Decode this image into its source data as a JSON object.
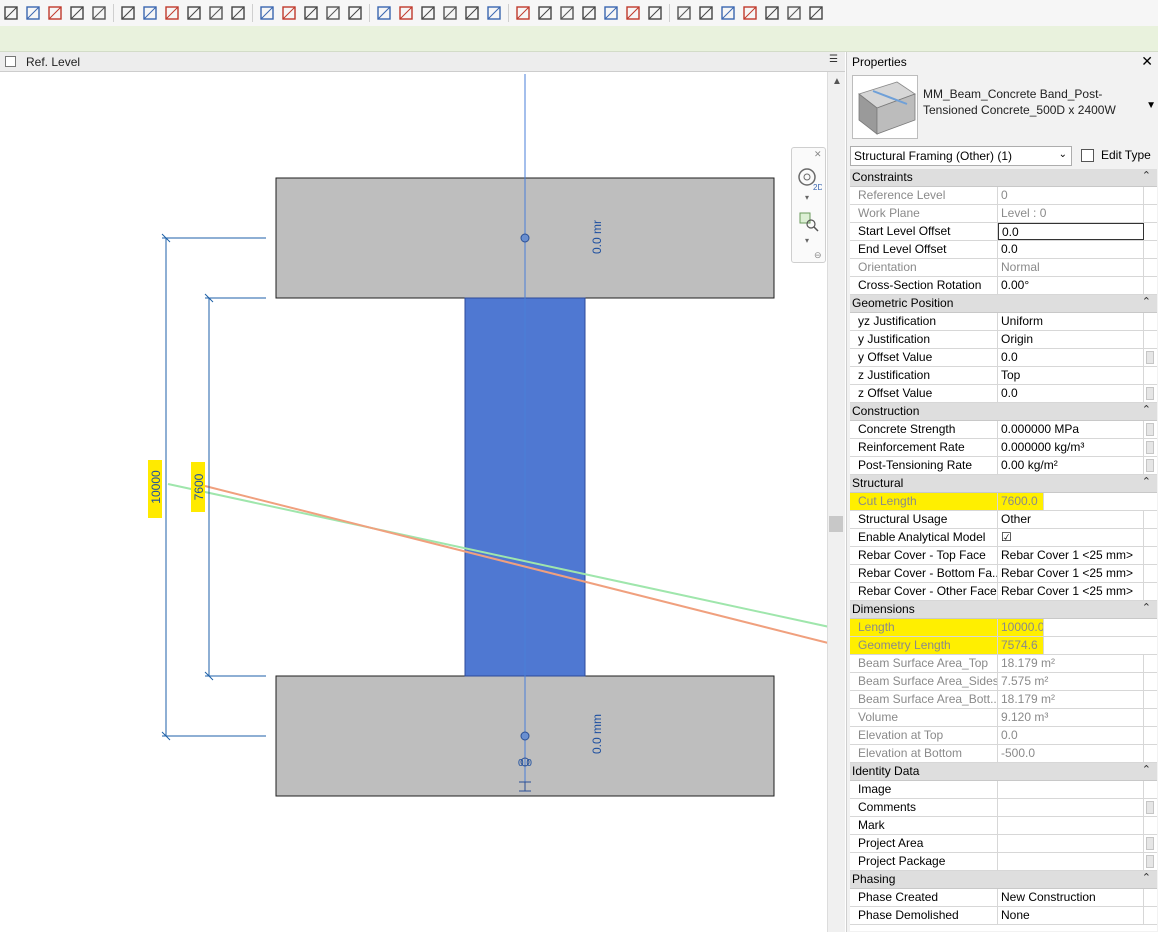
{
  "toolbar": {
    "icons": [
      "align-icon",
      "split-element-icon",
      "trim-icon",
      "rotate-icon",
      "array-icon",
      "mirror-icon",
      "dimension-icon",
      "measure-icon",
      "angular-icon",
      "arc-icon",
      "circle-icon",
      "spline-icon",
      "point-icon",
      "target-icon",
      "tag-icon",
      "region-icon",
      "wall-icon",
      "opening-icon",
      "text-icon",
      "frame-icon",
      "shape-icon",
      "cube-icon",
      "properties-icon",
      "filter-icon",
      "pin-icon",
      "copy-icon",
      "paste-icon",
      "link-icon",
      "view-icon",
      "select-icon",
      "gear-icon",
      "graph-icon",
      "pin-icon-2",
      "unpin-icon",
      "close-views-icon",
      "switch-windows-icon"
    ]
  },
  "view": {
    "tab_title": "Ref. Level"
  },
  "drawing": {
    "dim_outer": "10000",
    "dim_inner": "7600",
    "top_offset": "0.0 mr",
    "bottom_offset": "0.0 mm",
    "end_label": "0.0"
  },
  "properties": {
    "header": "Properties",
    "type_name": "MM_Beam_Concrete Band_Post-Tensioned Concrete_500D x 2400W",
    "selector": "Structural Framing (Other) (1)",
    "edit_type": "Edit Type",
    "groups": [
      {
        "title": "Constraints",
        "rows": [
          {
            "name": "Reference Level",
            "value": "0",
            "ro": true
          },
          {
            "name": "Work Plane",
            "value": "Level : 0",
            "ro": true
          },
          {
            "name": "Start Level Offset",
            "value": "0.0",
            "edit": true
          },
          {
            "name": "End Level Offset",
            "value": "0.0"
          },
          {
            "name": "Orientation",
            "value": "Normal",
            "ro": true
          },
          {
            "name": "Cross-Section Rotation",
            "value": "0.00°"
          }
        ]
      },
      {
        "title": "Geometric Position",
        "rows": [
          {
            "name": "yz Justification",
            "value": "Uniform"
          },
          {
            "name": "y Justification",
            "value": "Origin"
          },
          {
            "name": "y Offset Value",
            "value": "0.0",
            "rs": true
          },
          {
            "name": "z Justification",
            "value": "Top"
          },
          {
            "name": "z Offset Value",
            "value": "0.0",
            "rs": true
          }
        ]
      },
      {
        "title": "Construction",
        "rows": [
          {
            "name": "Concrete Strength",
            "value": "0.000000 MPa",
            "rs": true
          },
          {
            "name": "Reinforcement Rate",
            "value": "0.000000 kg/m³",
            "rs": true
          },
          {
            "name": "Post-Tensioning Rate",
            "value": "0.00 kg/m²",
            "rs": true
          }
        ]
      },
      {
        "title": "Structural",
        "rows": [
          {
            "name": "Cut Length",
            "value": "7600.0",
            "ro": true,
            "hl": true
          },
          {
            "name": "Structural Usage",
            "value": "Other"
          },
          {
            "name": "Enable Analytical Model",
            "value": "☑"
          },
          {
            "name": "Rebar Cover - Top Face",
            "value": "Rebar Cover 1 <25 mm>"
          },
          {
            "name": "Rebar Cover - Bottom Fa...",
            "value": "Rebar Cover 1 <25 mm>"
          },
          {
            "name": "Rebar Cover - Other Faces",
            "value": "Rebar Cover 1 <25 mm>"
          }
        ]
      },
      {
        "title": "Dimensions",
        "rows": [
          {
            "name": "Length",
            "value": "10000.0",
            "ro": true,
            "hl": true
          },
          {
            "name": "Geometry Length",
            "value": "7574.6",
            "ro": true,
            "hl": true
          },
          {
            "name": "Beam Surface Area_Top",
            "value": "18.179 m²",
            "ro": true
          },
          {
            "name": "Beam Surface Area_Sides",
            "value": "7.575 m²",
            "ro": true
          },
          {
            "name": "Beam Surface Area_Bott...",
            "value": "18.179 m²",
            "ro": true
          },
          {
            "name": "Volume",
            "value": "9.120 m³",
            "ro": true
          },
          {
            "name": "Elevation at Top",
            "value": "0.0",
            "ro": true
          },
          {
            "name": "Elevation at Bottom",
            "value": "-500.0",
            "ro": true
          }
        ]
      },
      {
        "title": "Identity Data",
        "rows": [
          {
            "name": "Image",
            "value": ""
          },
          {
            "name": "Comments",
            "value": "",
            "rs": true
          },
          {
            "name": "Mark",
            "value": ""
          },
          {
            "name": "Project Area",
            "value": "",
            "rs": true
          },
          {
            "name": "Project Package",
            "value": "",
            "rs": true
          }
        ]
      },
      {
        "title": "Phasing",
        "rows": [
          {
            "name": "Phase Created",
            "value": "New Construction"
          },
          {
            "name": "Phase Demolished",
            "value": "None"
          }
        ]
      }
    ]
  }
}
